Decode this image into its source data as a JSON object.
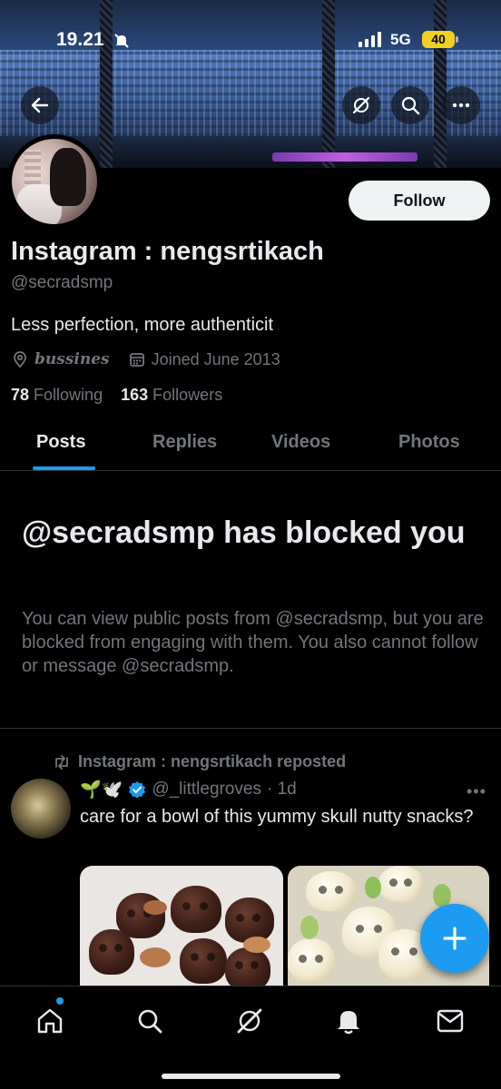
{
  "status_bar": {
    "time": "19.21",
    "network": "5G",
    "battery": "40"
  },
  "profile": {
    "name": "Instagram : nengsrtikach",
    "handle": "@secradsmp",
    "bio": "Less perfection, more authenticit",
    "location": "bussines",
    "joined": "Joined June 2013",
    "following_count": "78",
    "following_label": "Following",
    "followers_count": "163",
    "followers_label": "Followers",
    "follow_label": "Follow"
  },
  "tabs": [
    {
      "label": "Posts",
      "active": true
    },
    {
      "label": "Replies"
    },
    {
      "label": "Videos"
    },
    {
      "label": "Photos"
    }
  ],
  "blocked": {
    "title": "@secradsmp has blocked you",
    "body": "You can view public posts from @secradsmp, but you are blocked from engaging with them. You also cannot follow or message @secradsmp."
  },
  "post": {
    "repost_label": "Instagram : nengsrtikach reposted",
    "author_emoji": "🌱🕊️",
    "author_handle": "@_littlegroves",
    "time": "· 1d",
    "text": "care for a bowl of this yummy skull nutty snacks?",
    "more": "•••"
  },
  "colors": {
    "accent": "#1d9bf0",
    "verified": "#1d9bf0",
    "muted": "#71767b",
    "text": "#e7e9ea"
  },
  "icons": [
    "back-arrow-icon",
    "grok-icon",
    "search-icon",
    "more-icon",
    "location-icon",
    "calendar-icon",
    "repost-icon",
    "verified-icon",
    "plus-icon",
    "home-icon",
    "notifications-icon",
    "messages-icon"
  ]
}
